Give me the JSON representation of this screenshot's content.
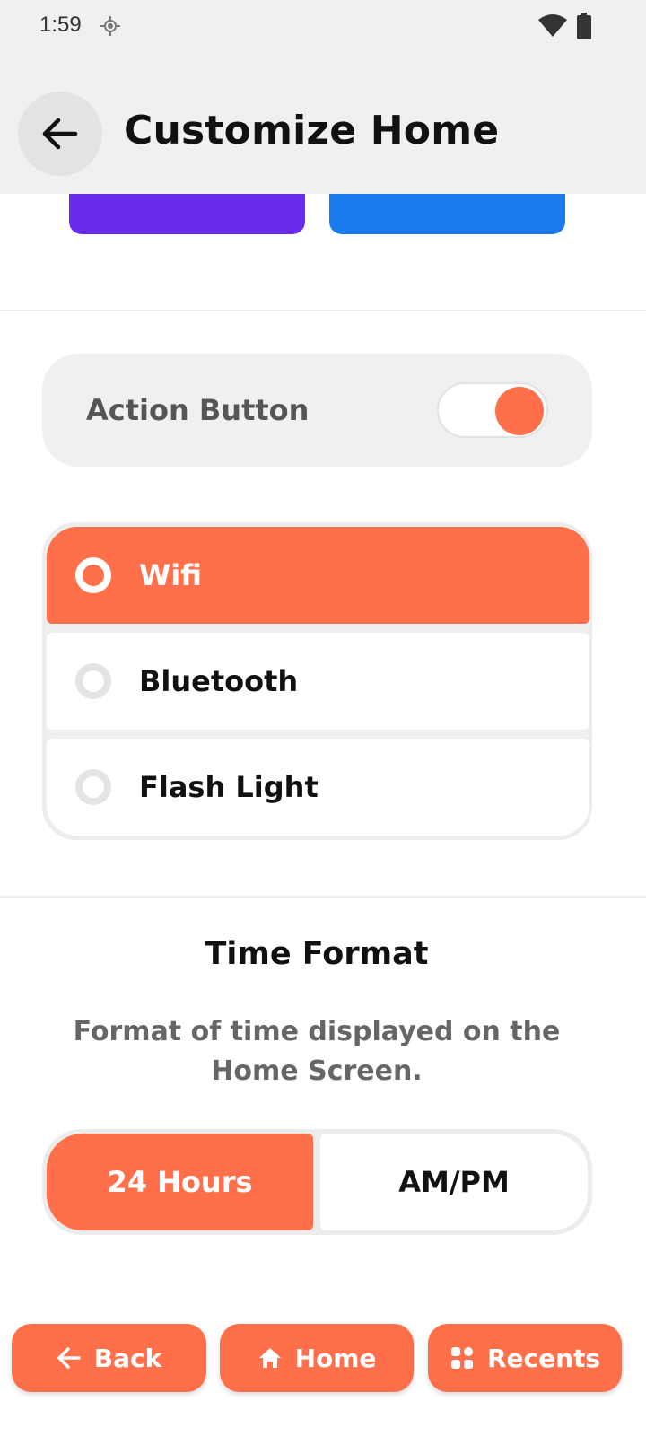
{
  "status_bar": {
    "time": "1:59",
    "icons": [
      "location-icon",
      "wifi-icon",
      "battery-icon"
    ]
  },
  "header": {
    "title": "Customize Home",
    "back_icon": "arrow-left-icon"
  },
  "colors": {
    "accent": "#ff6f4a",
    "card_purple": "#6a2cec",
    "card_blue": "#1a7bf0",
    "surface": "#f0f0f0"
  },
  "action_button": {
    "label": "Action Button",
    "enabled": true
  },
  "action_options": {
    "selected": "Wifi",
    "items": [
      {
        "label": "Wifi",
        "selected": true
      },
      {
        "label": "Bluetooth",
        "selected": false
      },
      {
        "label": "Flash Light",
        "selected": false
      }
    ]
  },
  "time_format": {
    "title": "Time Format",
    "description": "Format of time displayed on the Home Screen.",
    "options": [
      {
        "label": "24 Hours",
        "selected": true
      },
      {
        "label": "AM/PM",
        "selected": false
      }
    ]
  },
  "bottom_nav": {
    "back_label": "Back",
    "home_label": "Home",
    "recents_label": "Recents",
    "back_icon": "arrow-left-icon",
    "home_icon": "home-icon",
    "recents_icon": "grid-icon"
  }
}
